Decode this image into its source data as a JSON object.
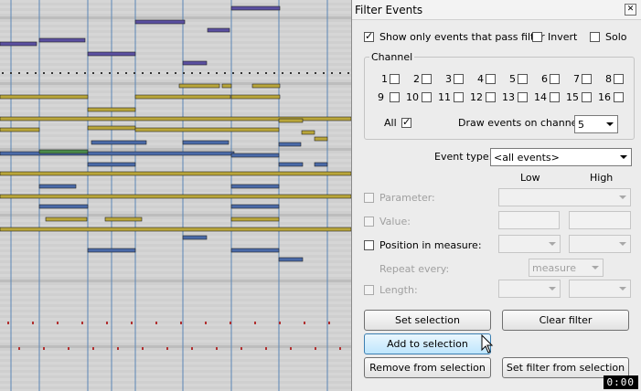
{
  "dialog": {
    "title": "Filter Events",
    "close_glyph": "✕",
    "show_only_label": "Show only events that pass filter",
    "show_only_checked": true,
    "invert_label": "Invert",
    "invert_checked": false,
    "solo_label": "Solo",
    "solo_checked": false,
    "channel_group_label": "Channel",
    "channels": [
      "1",
      "2",
      "3",
      "4",
      "5",
      "6",
      "7",
      "8",
      "9",
      "10",
      "11",
      "12",
      "13",
      "14",
      "15",
      "16"
    ],
    "all_label": "All",
    "all_checked": true,
    "draw_on_channel_label": "Draw events on channel:",
    "draw_on_channel_value": "5",
    "event_type_label": "Event type:",
    "event_type_value": "<all events>",
    "low_header": "Low",
    "high_header": "High",
    "parameter_label": "Parameter:",
    "value_label": "Value:",
    "position_label": "Position in measure:",
    "repeat_label": "Repeat every:",
    "repeat_value": "measure",
    "length_label": "Length:",
    "buttons": {
      "set_selection": "Set selection",
      "clear_filter": "Clear filter",
      "add_to_selection": "Add to selection",
      "remove_from_selection": "Remove from selection",
      "set_filter_from_selection": "Set filter from selection"
    }
  },
  "status": {
    "clock": "0:00"
  },
  "colors": {
    "note_purple": "#5a4fa0",
    "note_olive": "#b9a63a",
    "note_blue": "#4a6aa8",
    "note_green": "#4a8a4a",
    "hover_blue": "#bee6fd"
  },
  "icons": {
    "cursor": "mouse-pointer-icon",
    "close": "close-icon",
    "dropdown": "chevron-down-icon"
  }
}
